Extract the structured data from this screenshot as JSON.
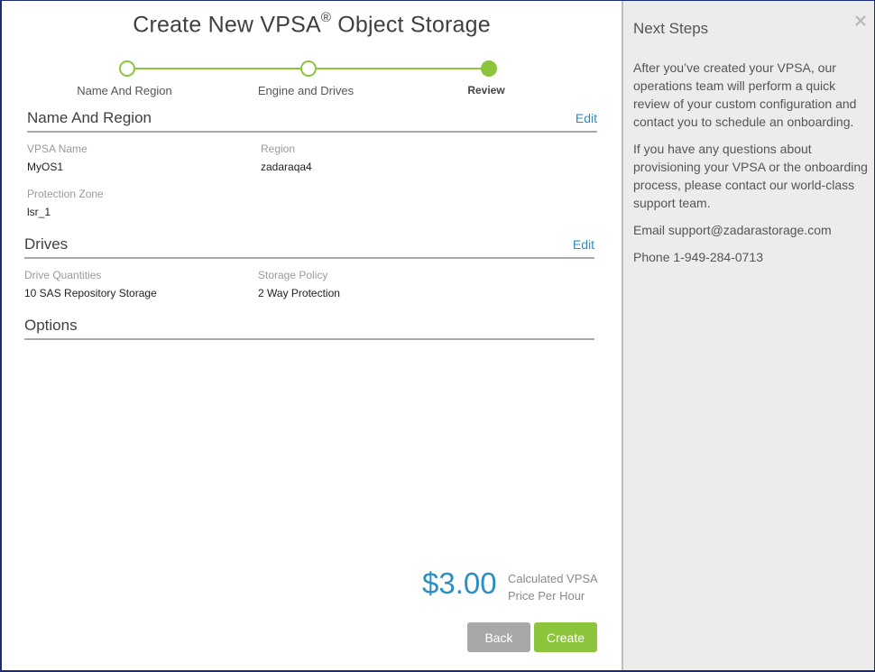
{
  "wizard": {
    "title": "Create New VPSA",
    "title_mark": "®",
    "title_suffix": "Object Storage",
    "steps": [
      {
        "label": "Name And Region",
        "state": "done"
      },
      {
        "label": "Engine and Drives",
        "state": "done"
      },
      {
        "label": "Review",
        "state": "active"
      }
    ]
  },
  "name_region": {
    "title": "Name And Region",
    "edit_label": "Edit",
    "vpsa_name_label": "VPSA Name",
    "vpsa_name_value": "MyOS1",
    "region_label": "Region",
    "region_value": "zadaraqa4",
    "protection_zone_label": "Protection Zone",
    "protection_zone_value": "lsr_1"
  },
  "drives": {
    "title": "Drives",
    "edit_label": "Edit",
    "quantities_label": "Drive Quantities",
    "quantities_value": "10 SAS Repository Storage",
    "policy_label": "Storage Policy",
    "policy_value": "2 Way Protection"
  },
  "options": {
    "title": "Options"
  },
  "pricing": {
    "amount": "$3.00",
    "desc_line1": "Calculated VPSA",
    "desc_line2": "Price Per Hour"
  },
  "buttons": {
    "back_label": "Back",
    "create_label": "Create"
  },
  "side": {
    "title": "Next Steps",
    "para1": "After you’ve created your VPSA, our operations team will perform a quick review of your custom configuration and contact you to schedule an onboarding.",
    "para2": "If you have any questions about provisioning your VPSA or the onboarding process, please contact our world-class support team.",
    "email": "Email support@zadarastorage.com",
    "phone": "Phone 1-949-284-0713"
  },
  "colors": {
    "accent_green": "#8cc43c",
    "link_blue": "#2b8fc2",
    "frame_border": "#1c2a7a"
  }
}
